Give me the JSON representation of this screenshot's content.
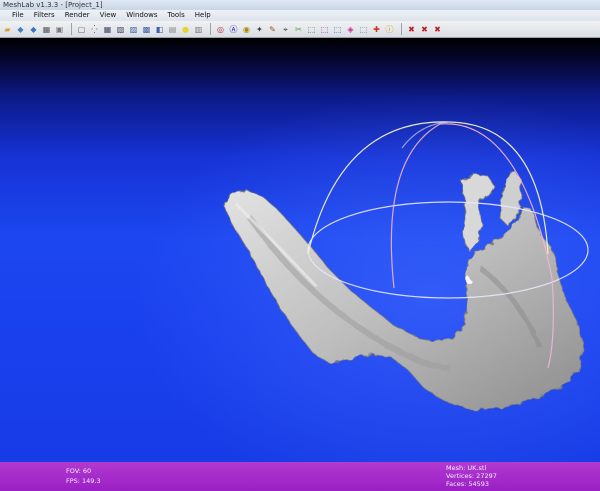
{
  "window": {
    "title": "MeshLab v1.3.3 - [Project_1]"
  },
  "menu": [
    "File",
    "Filters",
    "Render",
    "View",
    "Windows",
    "Tools",
    "Help"
  ],
  "toolbar": {
    "groups": [
      [
        {
          "icon": "open-folder-icon",
          "glyph": "▰",
          "color": "#d9a12b"
        },
        {
          "icon": "open-project-icon",
          "glyph": "◆",
          "color": "#3f7fbf"
        },
        {
          "icon": "reload-icon",
          "glyph": "◆",
          "color": "#3f6fbf"
        },
        {
          "icon": "save-icon",
          "glyph": "▦",
          "color": "#555"
        },
        {
          "icon": "snapshot-icon",
          "glyph": "▣",
          "color": "#777"
        }
      ],
      [
        {
          "icon": "bbox-icon",
          "glyph": "▢",
          "color": "#666"
        },
        {
          "icon": "points-icon",
          "glyph": "⁛",
          "color": "#555"
        },
        {
          "icon": "wireframe-icon",
          "glyph": "▦",
          "color": "#446"
        },
        {
          "icon": "hidden-lines-icon",
          "glyph": "▧",
          "color": "#446"
        },
        {
          "icon": "flat-lines-icon",
          "glyph": "▨",
          "color": "#3d5fa8"
        },
        {
          "icon": "flat-shading-icon",
          "glyph": "▩",
          "color": "#3d5fa8"
        },
        {
          "icon": "smooth-shading-icon",
          "glyph": "◧",
          "color": "#3d5fa8"
        },
        {
          "icon": "texture-icon",
          "glyph": "▤",
          "color": "#888"
        },
        {
          "icon": "light-icon",
          "glyph": "●",
          "color": "#e8d12a"
        },
        {
          "icon": "back-face-icon",
          "glyph": "▥",
          "color": "#777"
        }
      ],
      [
        {
          "icon": "trackball-icon",
          "glyph": "◎",
          "color": "#b03030"
        },
        {
          "icon": "annotation-icon",
          "glyph": "Ⓐ",
          "color": "#1b1bbb"
        },
        {
          "icon": "measure-icon",
          "glyph": "◉",
          "color": "#aa8800"
        },
        {
          "icon": "select-vertices-icon",
          "glyph": "✦",
          "color": "#3c3c3c"
        },
        {
          "icon": "paint-brush-icon",
          "glyph": "✎",
          "color": "#8a5a20"
        },
        {
          "icon": "pick-points-icon",
          "glyph": "⌖",
          "color": "#444"
        },
        {
          "icon": "align-icon",
          "glyph": "✂",
          "color": "#5a2"
        },
        {
          "icon": "select-faces-icon",
          "glyph": "⬚",
          "color": "#2a7a2a"
        },
        {
          "icon": "select-connected-icon",
          "glyph": "⬚",
          "color": "#8a2a8a"
        },
        {
          "icon": "select-region-icon",
          "glyph": "⬚",
          "color": "#2a5aa8"
        },
        {
          "icon": "color-select-icon",
          "glyph": "◈",
          "color": "#c42a8a"
        },
        {
          "icon": "mesh-edit-icon",
          "glyph": "⬚",
          "color": "#2a8a8a"
        },
        {
          "icon": "z-paint-icon",
          "glyph": "✚",
          "color": "#d0301a"
        },
        {
          "icon": "info-icon",
          "glyph": "ⓘ",
          "color": "#d0a000"
        }
      ],
      [
        {
          "icon": "delete-vertices-icon",
          "glyph": "✖",
          "color": "#c02020"
        },
        {
          "icon": "delete-faces-icon",
          "glyph": "✖",
          "color": "#c02020"
        },
        {
          "icon": "delete-all-icon",
          "glyph": "✖",
          "color": "#c02020"
        }
      ]
    ]
  },
  "status": {
    "fov": "FOV: 60",
    "fps": "FPS:   149.3",
    "mesh": "Mesh: UK.stl",
    "vertices": "Vertices: 27297",
    "faces": "Faces: 54593"
  },
  "colors": {
    "viewport_blue": "#1c47f0",
    "status_purple": "#a52bcb",
    "mesh_gray": "#c9c9c9"
  }
}
